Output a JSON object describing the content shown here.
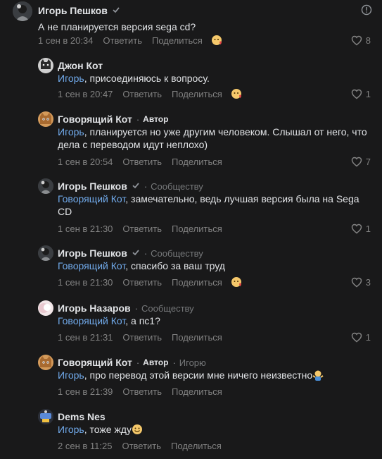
{
  "labels": {
    "reply": "Ответить",
    "share": "Поделиться"
  },
  "colors": {
    "background": "#19191a",
    "mention": "#71aaeb",
    "meta": "#828282",
    "like": "#828282",
    "reaction_heart": "#e64646"
  },
  "root": {
    "author": "Игорь Пешков",
    "text": "А не планируется версия sega cd?",
    "time": "1 сен в 20:34",
    "likes": "8",
    "icons": [
      "verified-icon",
      "info-icon",
      "reaction-icon",
      "heart-icon"
    ]
  },
  "replies": [
    {
      "author": "Джон Кот",
      "mention": "Игорь",
      "text": ", присоединяюсь к вопросу.",
      "time": "1 сен в 20:47",
      "likes": "1"
    },
    {
      "author": "Говорящий Кот",
      "badge": "Автор",
      "mention": "Игорь",
      "text": ", планируется но уже другим человеком. Слышал от него, что дела с переводом идут неплохо)",
      "time": "1 сен в 20:54",
      "likes": "7"
    },
    {
      "author": "Игорь Пешков",
      "target": "Сообществу",
      "mention": "Говорящий Кот",
      "text": ", замечательно, ведь лучшая версия была на Sega CD",
      "time": "1 сен в 21:30",
      "likes": "1"
    },
    {
      "author": "Игорь Пешков",
      "target": "Сообществу",
      "mention": "Говорящий Кот",
      "text": ", спасибо за ваш труд",
      "time": "1 сен в 21:30",
      "likes": "3"
    },
    {
      "author": "Игорь Назаров",
      "target": "Сообществу",
      "mention": "Говорящий Кот",
      "text": ", а пс1?",
      "time": "1 сен в 21:31",
      "likes": "1"
    },
    {
      "author": "Говорящий Кот",
      "badge": "Автор",
      "target": "Игорю",
      "mention": "Игорь",
      "text": ", про перевод этой версии мне ничего неизвестно",
      "time": "1 сен в 21:39",
      "likes": ""
    },
    {
      "author": "Dems Nes",
      "mention": "Игорь",
      "text": ", тоже жду",
      "time": "2 сен в 11:25",
      "likes": ""
    }
  ]
}
